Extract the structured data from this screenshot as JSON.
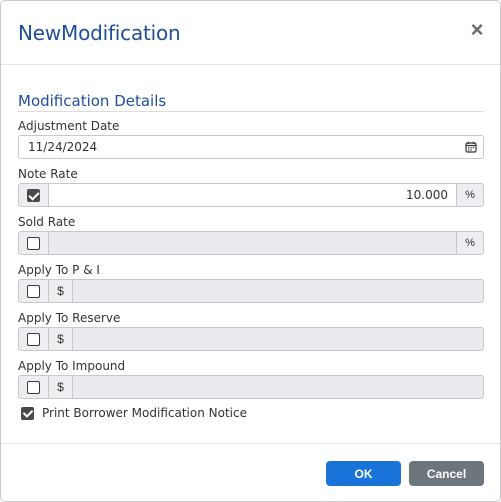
{
  "dialog": {
    "title": "NewModification",
    "close_icon": "close-icon"
  },
  "section": {
    "title": "Modification Details"
  },
  "fields": {
    "adjustment_date": {
      "label": "Adjustment Date",
      "value": "11/24/2024",
      "icon": "calendar-icon"
    },
    "note_rate": {
      "label": "Note Rate",
      "checked": true,
      "value": "10.000",
      "suffix": "%"
    },
    "sold_rate": {
      "label": "Sold Rate",
      "checked": false,
      "value": "",
      "suffix": "%"
    },
    "apply_pi": {
      "label": "Apply To P & I",
      "checked": false,
      "prefix": "$",
      "value": ""
    },
    "apply_reserve": {
      "label": "Apply To Reserve",
      "checked": false,
      "prefix": "$",
      "value": ""
    },
    "apply_impound": {
      "label": "Apply To Impound",
      "checked": false,
      "prefix": "$",
      "value": ""
    }
  },
  "print_notice": {
    "label": "Print Borrower Modification Notice",
    "checked": true
  },
  "buttons": {
    "ok": "OK",
    "cancel": "Cancel"
  },
  "colors": {
    "title": "#1f4e9c",
    "ok": "#1a73d9",
    "cancel": "#6d757d"
  }
}
